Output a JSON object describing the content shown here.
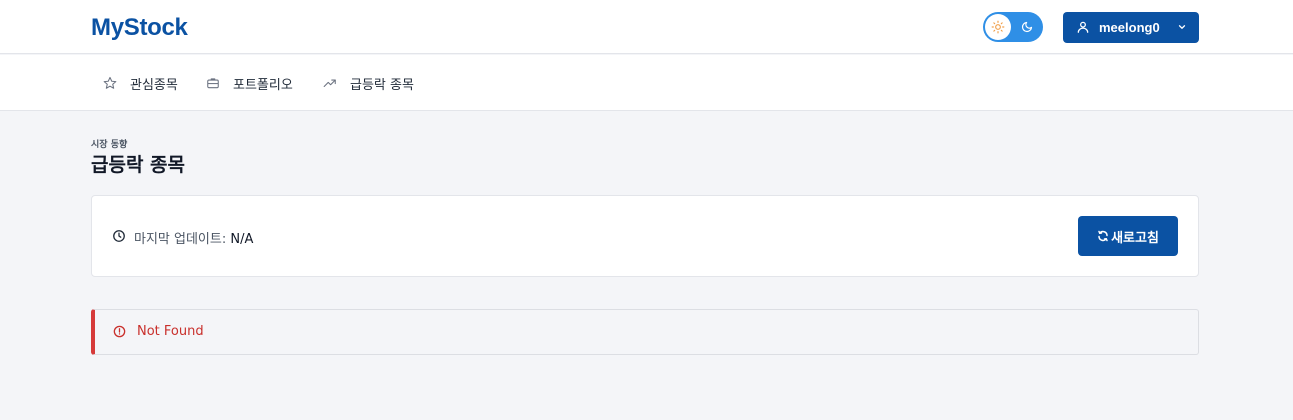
{
  "header": {
    "brand": "MyStock",
    "theme_toggle": {
      "state": "light",
      "sun_icon": "sun-icon",
      "moon_icon": "moon-icon"
    },
    "user": {
      "name": "meelong0",
      "icon": "user-icon",
      "chevron": "chevron-down-icon"
    }
  },
  "nav": {
    "items": [
      {
        "label": "관심종목",
        "icon": "star-icon"
      },
      {
        "label": "포트폴리오",
        "icon": "briefcase-icon"
      },
      {
        "label": "급등락 종목",
        "icon": "trending-up-icon"
      }
    ]
  },
  "page": {
    "eyebrow": "시장 동향",
    "title": "급등락 종목"
  },
  "info_card": {
    "last_update_label": "마지막 업데이트:",
    "last_update_value": "N/A",
    "refresh_label": "새로고침"
  },
  "alert": {
    "message": "Not Found"
  },
  "colors": {
    "brand": "#0b52a3",
    "toggle": "#2f8fe6",
    "background": "#f4f5f8",
    "error": "#d63a3a"
  }
}
